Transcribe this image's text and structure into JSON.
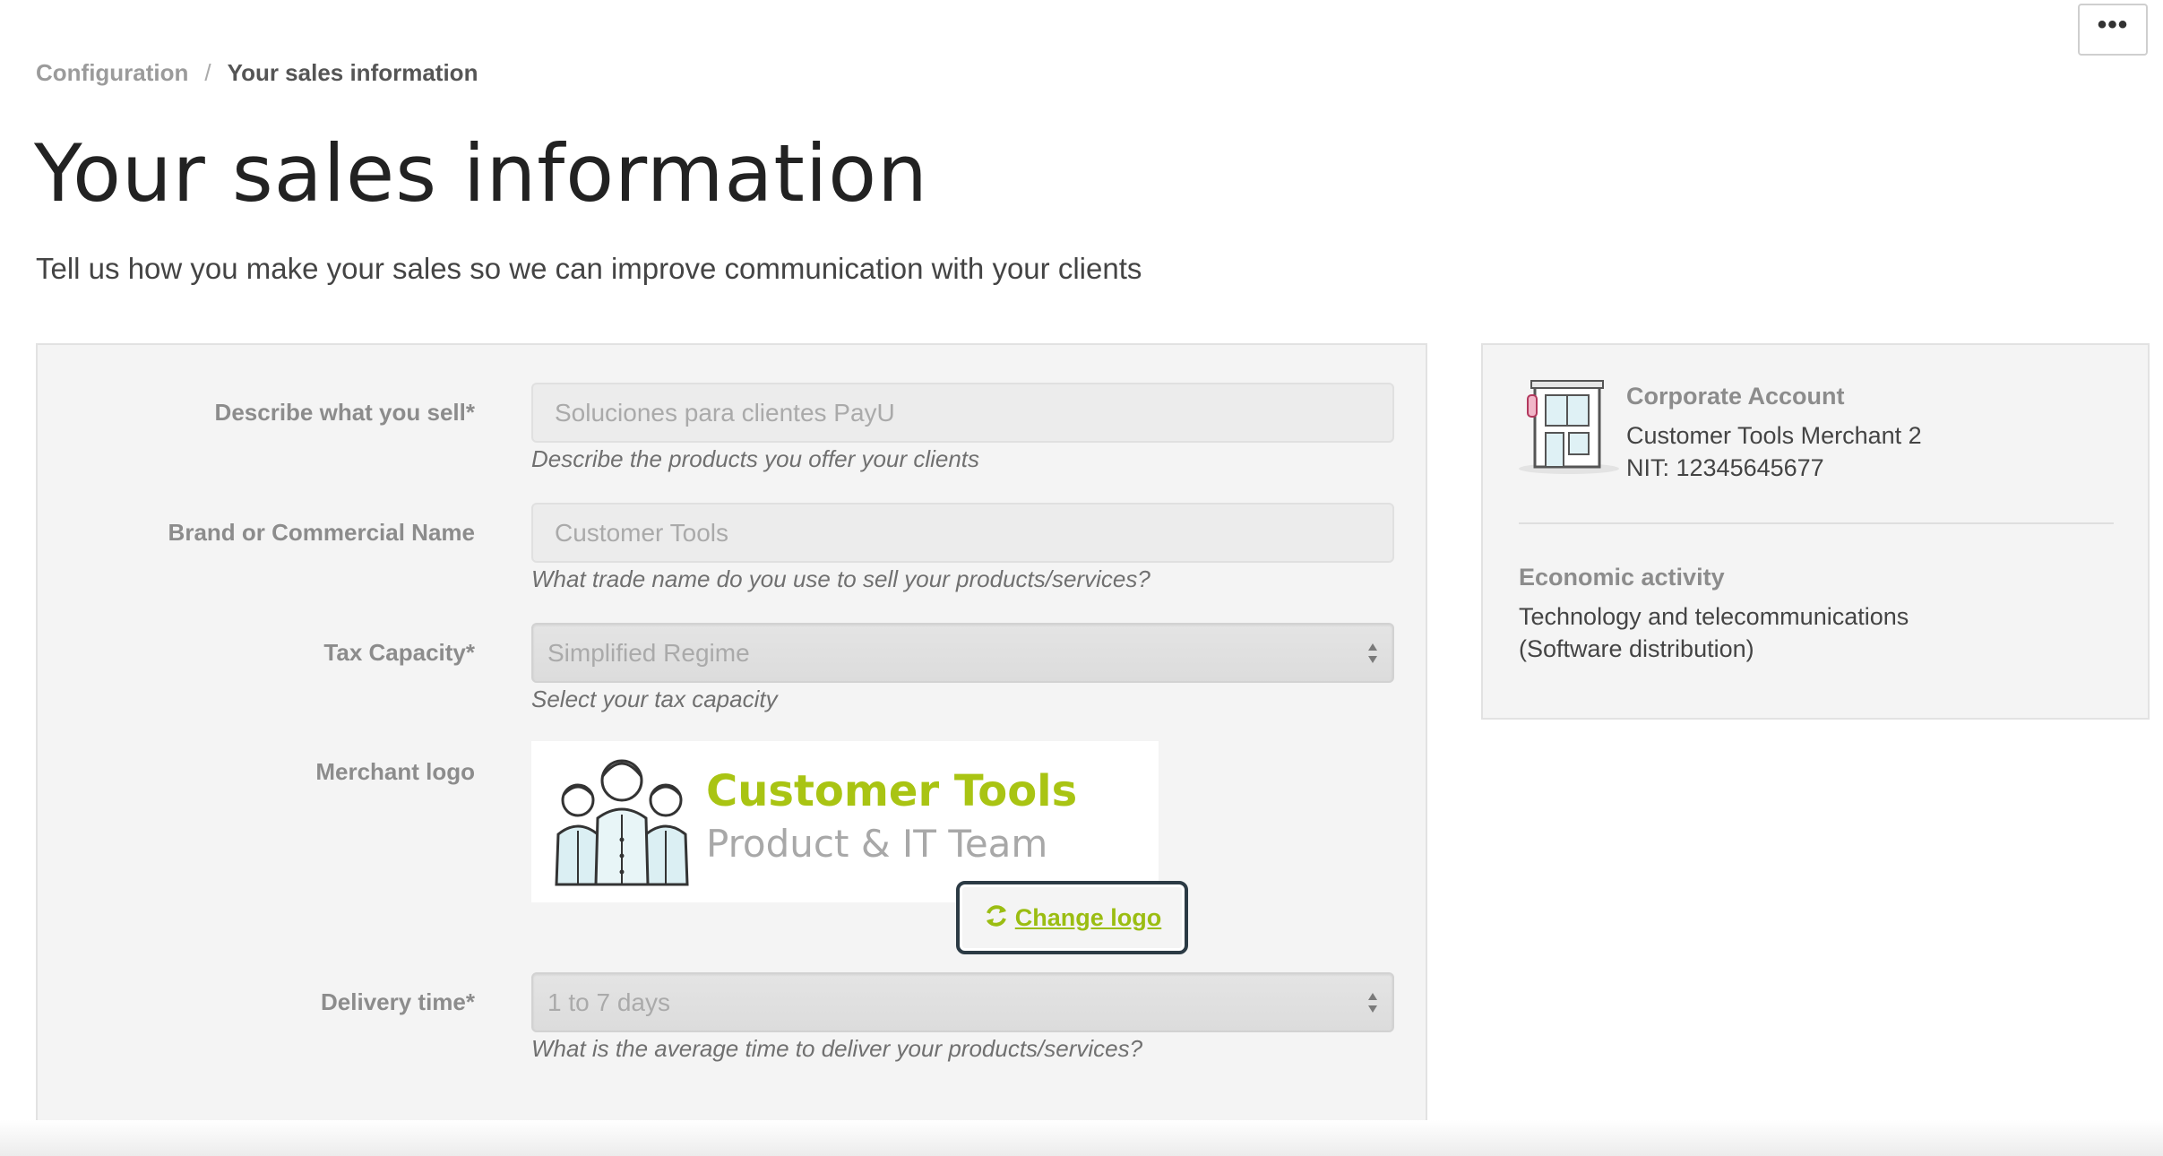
{
  "header": {
    "more_label": "•••"
  },
  "breadcrumb": {
    "parent": "Configuration",
    "separator": "/",
    "current": "Your sales information"
  },
  "page": {
    "title": "Your sales information",
    "subtitle": "Tell us how you make your sales so we can improve communication with your clients"
  },
  "form": {
    "describe": {
      "label": "Describe what you sell*",
      "value": "Soluciones para clientes PayU",
      "help": "Describe the products you offer your clients"
    },
    "brand": {
      "label": "Brand or Commercial Name",
      "value": "Customer Tools",
      "help": "What trade name do you use to sell your products/services?"
    },
    "tax": {
      "label": "Tax Capacity*",
      "value": "Simplified Regime",
      "help": "Select your tax capacity"
    },
    "logo": {
      "label": "Merchant logo",
      "brand_text": "Customer Tools",
      "team_text": "Product & IT Team",
      "change_label": "Change logo"
    },
    "delivery": {
      "label": "Delivery time*",
      "value": "1 to 7 days",
      "help": "What is the average time to deliver your products/services?"
    }
  },
  "account": {
    "title": "Corporate Account",
    "merchant": "Customer Tools Merchant 2",
    "nit": "NIT: 12345645677",
    "activity_title": "Economic activity",
    "activity_line1": "Technology and telecommunications",
    "activity_line2": "(Software distribution)"
  },
  "colors": {
    "accent_green": "#9bbd12",
    "panel_bg": "#f4f4f4",
    "focus_border": "#2b3a44"
  },
  "icons": [
    "more-icon",
    "refresh-icon",
    "store-icon",
    "select-arrows-icon"
  ]
}
